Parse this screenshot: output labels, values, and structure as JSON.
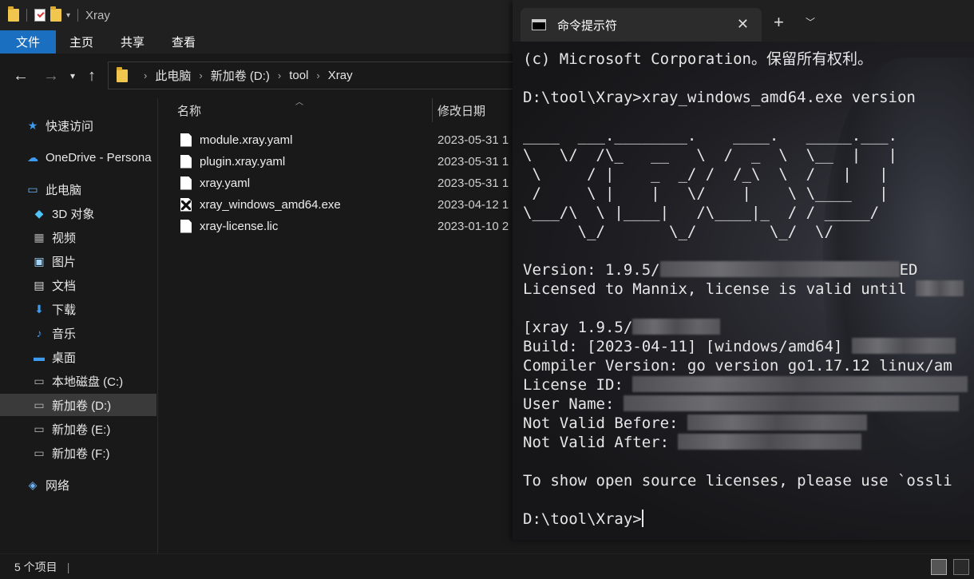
{
  "explorer": {
    "window_title": "Xray",
    "ribbon_tabs": [
      "文件",
      "主页",
      "共享",
      "查看"
    ],
    "address": [
      "此电脑",
      "新加卷 (D:)",
      "tool",
      "Xray"
    ],
    "columns": {
      "name": "名称",
      "date": "修改日期"
    },
    "nav_items": [
      {
        "label": "快速访问",
        "icon": "star-icon"
      },
      {
        "label": "OneDrive - Persona",
        "icon": "cloud-icon"
      },
      {
        "label": "此电脑",
        "icon": "computer-icon"
      },
      {
        "label": "3D 对象",
        "icon": "cube-icon"
      },
      {
        "label": "视频",
        "icon": "video-icon"
      },
      {
        "label": "图片",
        "icon": "picture-icon"
      },
      {
        "label": "文档",
        "icon": "document-icon"
      },
      {
        "label": "下载",
        "icon": "download-icon"
      },
      {
        "label": "音乐",
        "icon": "music-icon"
      },
      {
        "label": "桌面",
        "icon": "desktop-icon"
      },
      {
        "label": "本地磁盘 (C:)",
        "icon": "drive-icon"
      },
      {
        "label": "新加卷 (D:)",
        "icon": "drive-icon",
        "selected": true
      },
      {
        "label": "新加卷 (E:)",
        "icon": "drive-icon"
      },
      {
        "label": "新加卷 (F:)",
        "icon": "drive-icon"
      },
      {
        "label": "网络",
        "icon": "network-icon"
      }
    ],
    "files": [
      {
        "name": "module.xray.yaml",
        "date": "2023-05-31 1"
      },
      {
        "name": "plugin.xray.yaml",
        "date": "2023-05-31 1"
      },
      {
        "name": "xray.yaml",
        "date": "2023-05-31 1"
      },
      {
        "name": "xray_windows_amd64.exe",
        "date": "2023-04-12 1",
        "type": "exe"
      },
      {
        "name": "xray-license.lic",
        "date": "2023-01-10 2"
      }
    ],
    "status": "5 个项目"
  },
  "terminal": {
    "tab_title": "命令提示符",
    "lines": [
      "(c) Microsoft Corporation。保留所有权利。",
      "",
      "D:\\tool\\Xray>xray_windows_amd64.exe version",
      "",
      "____  ___.________.    ____.   _____.___.",
      "\\   \\/  /\\_   __   \\  /  _  \\  \\__  |   |",
      " \\     / |    _  _/ /  /_\\  \\  /   |   |",
      " /     \\ |    |   \\/    |    \\ \\____   |",
      "\\___/\\  \\ |____|   /\\____|_  / / _____/",
      "      \\_/       \\_/        \\_/  \\/"
    ],
    "version_prefix": "Version: 1.9.5/",
    "version_suffix": "ED",
    "licensed_prefix": "Licensed to Mannix, license is valid until ",
    "build_bracket": "[xray 1.9.5/",
    "build_line": "Build: [2023-04-11] [windows/amd64] ",
    "compiler_line": "Compiler Version: go version go1.17.12 linux/am",
    "license_id": "License ID: ",
    "user_name": "User Name: ",
    "not_before": "Not Valid Before: ",
    "not_after": "Not Valid After: ",
    "oss_line": "To show open source licenses, please use `ossli",
    "prompt": "D:\\tool\\Xray>"
  }
}
